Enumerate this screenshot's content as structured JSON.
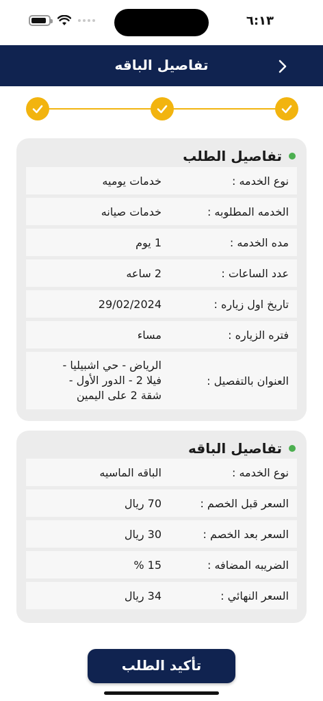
{
  "status_bar": {
    "time": "٦:١٣"
  },
  "header": {
    "title": "تفاصيل الباقه"
  },
  "stepper": {
    "completed_steps": 3,
    "total_steps": 3,
    "color": "#f2b40f"
  },
  "order_card": {
    "title": "تفاصيل الطلب",
    "rows": [
      {
        "label": "نوع الخدمه :",
        "value": "خدمات يوميه"
      },
      {
        "label": "الخدمه المطلوبه :",
        "value": "خدمات صيانه"
      },
      {
        "label": "مده الخدمه  :",
        "value": "1 يوم"
      },
      {
        "label": "عدد الساعات :",
        "value": "2 ساعه"
      },
      {
        "label": "تاريخ اول زياره :",
        "value": "29/02/2024"
      },
      {
        "label": "فتره الزياره :",
        "value": "مساء"
      },
      {
        "label": "العنوان بالتفصيل  :",
        "value_lines": [
          "الرياض - حي اشبيليا -",
          "فيلا 2 - الدور الأول -",
          "شقة 2 على اليمين"
        ]
      }
    ]
  },
  "package_card": {
    "title": "تفاصيل الباقه",
    "rows": [
      {
        "label": "نوع الخدمه :",
        "value": "الباقه الماسيه"
      },
      {
        "label": "السعر قبل الخصم :",
        "value": "70  ريال"
      },
      {
        "label": "السعر بعد الخصم :",
        "value": "30  ريال"
      },
      {
        "label": "الضريبه المضافه :",
        "value": "15 %"
      },
      {
        "label": "السعر النهائي :",
        "value": "34  ريال"
      }
    ]
  },
  "confirm_button": {
    "label": "تأكيد الطلب"
  },
  "colors": {
    "primary": "#102350",
    "accent": "#f2b40f",
    "status_dot": "#4caf50",
    "card_bg": "#ececec",
    "row_bg": "#f7f7f7"
  }
}
